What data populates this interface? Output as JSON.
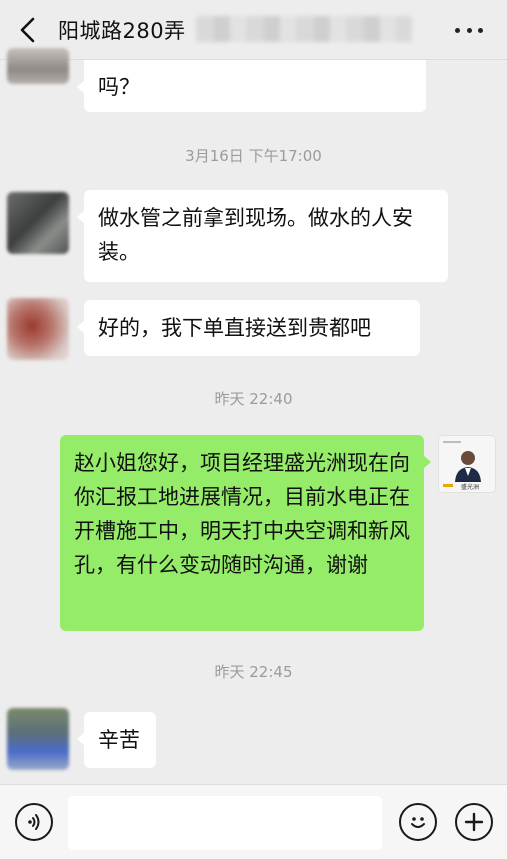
{
  "header": {
    "title": "阳城路280弄",
    "back_icon": "chevron-left-icon",
    "more_icon": "more-dots-icon"
  },
  "messages": [
    {
      "side": "left",
      "text": "吗？"
    },
    {
      "side": "left",
      "text": "做水管之前拿到现场。做水的人安装。"
    },
    {
      "side": "left",
      "text": "好的，我下单直接送到贵都吧"
    },
    {
      "side": "right",
      "text": "赵小姐您好，项目经理盛光洲现在向你汇报工地进展情况，目前水电正在开槽施工中，明天打中央空调和新风孔，有什么变动随时沟通，谢谢"
    },
    {
      "side": "left",
      "text": "辛苦"
    }
  ],
  "timestamps": [
    "3月16日 下午17:00",
    "昨天 22:40",
    "昨天 22:45"
  ],
  "self_avatar": {
    "name_tag": "盛光洲"
  },
  "input_bar": {
    "voice_icon": "voice-icon",
    "emoji_icon": "emoji-icon",
    "plus_icon": "plus-icon",
    "text_value": ""
  },
  "colors": {
    "background": "#ededed",
    "self_bubble": "#95ec69",
    "other_bubble": "#ffffff",
    "timestamp": "#9b9b9b"
  }
}
